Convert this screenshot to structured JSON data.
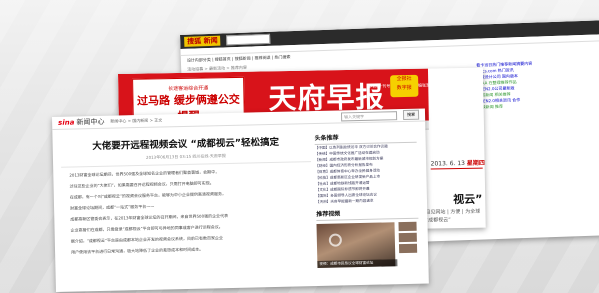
{
  "sohu": {
    "logo": "搜狐 新闻",
    "line1": "设计内部分类 | 搜狐首页 | 搜狐新闻 | 推荐阅读 | 热门搜索",
    "line2": "活动招募 > 最新活动 > 推荐内容",
    "right": [
      "看卡当日热门推荐新闻摘要内容",
      "Mocs.com 热门资讯",
      "东流设计公司 国内版本",
      "APAA 在整理推荐作品",
      "DPEN2.0公司最新版",
      "搜狐新闻 相关推荐",
      "OPEN2.0相关资讯 合作",
      "三峡新闻 推荐"
    ]
  },
  "tianfu": {
    "ad_top": "长途客运综合开通",
    "ad_main": "过马路 缓步俩遵公交提醒",
    "title": "天府早报",
    "info": "国内统一刊号CN51-0034 主编张澍 广告热线",
    "badge_line1": "全报社",
    "badge_line2": "数字报",
    "date": "2013. 6. 13",
    "weekday": "星期四",
    "headline": "视云” 轻松搞定",
    "sub1": "目见网站 | 方便 | 为全球",
    "sub2": "“成都视云”"
  },
  "sina": {
    "logo": "sina",
    "logo_text": "新闻中心",
    "crumb": "新闻中心 > 国内新闻 > 正文",
    "search_placeholder": "输入关键字",
    "search_btn": "搜索",
    "headline": "大佬要开远程视频会议 “成都视云”轻松搞定",
    "meta": "2013年06月13日 03:15  四川在线-天府早报",
    "paragraphs": [
      "2013财富全球论坛期间，世界500强及全球知名企业的管理者们聚首蓉城，会期中，",
      "过往这些企业的“大佬们”，如果需要召开远程视频会议，只需打开电脑即可实现。",
      "在成都，有一个叫“成都视云”的视频会议服务平台，能够为中小企业提供高清视频服务，",
      "财富全球论坛期间，成都“一站式”服务平台——",
      "成都高新区管委会表示，在2013年财富全球论坛的召开期间，来自世界500强的企业代表",
      "企业高管们在成都，只需登录“成都视云”平台即可与异地的同事或客户进行远程会议。",
      "据介绍，“成都视云”平台是由成都本地企业开发的视频会议系统，目前已有数百家企业",
      "用户使用该平台进行日常沟通，极大地降低了企业的差旅成本和时间成本。"
    ],
    "side_title": "头条推荐",
    "side_items": [
      "【中国】以色列副总统访华 双方讨论合作议题",
      "【传统】中国传统文化推广活动在蓉启动",
      "【新闻】成都市政府发布最新城市规划方案",
      "【财经】国内经济形势分析报告发布",
      "【体育】成都体育中心举办全民健身活动",
      "【科技】成都高新区企业研发新产品上市",
      "【社会】成都地铁新线路开通运营",
      "【文化】成都国际非遗节即将开幕",
      "【国际】多国领导人出席全球论坛会议",
      "【天府】天府早报最新一期内容速览"
    ],
    "video_title": "推荐视频",
    "video_caption": "视频：成都市民热议全球财富论坛"
  }
}
